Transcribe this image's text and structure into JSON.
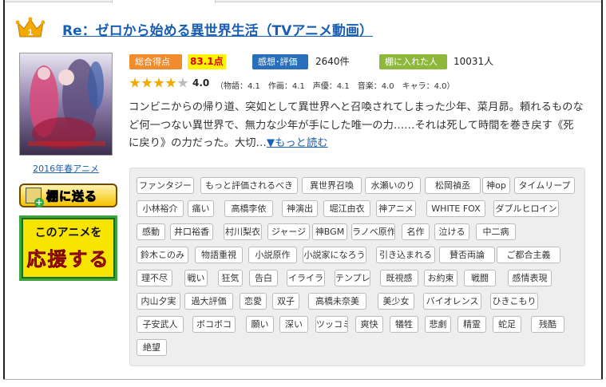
{
  "anime": {
    "rank": "1",
    "title": "Re：ゼロから始める異世界生活（TVアニメ動画）",
    "season": "2016年春アニメ"
  },
  "stats": {
    "total_score_label": "総合得点",
    "total_score": "83.1点",
    "reviews_label": "感想･評価",
    "reviews_count": "2640件",
    "shelf_label": "棚に入れた人",
    "shelf_count": "10031人"
  },
  "rating": {
    "overall": 4.0,
    "overall_text": "4.0",
    "stars_filled": 4,
    "stars_total": 5,
    "detail": "（物語：4.1　作画：4.1　声優：4.1　音楽：4.0　キャラ：4.0）"
  },
  "synopsis": {
    "text": "コンビニからの帰り道、突如として異世界へと召喚されてしまった少年、菜月昴。頼れるものなど何一つない異世界で、無力な少年が手にした唯一の力……それは死して時間を巻き戻す《死に戻り》の力だった。大切…",
    "more_label": "▼もっと読む"
  },
  "buttons": {
    "shelf": "棚に送る",
    "support_line1": "このアニメを",
    "support_line2": "応援する"
  },
  "tags": [
    "ファンタジー",
    "もっと評価されるべき",
    "異世界召喚",
    "水瀬いのり",
    "松岡禎丞",
    "神op",
    "タイムリープ",
    "小林裕介",
    "痛い",
    "高橋李依",
    "神演出",
    "堀江由衣",
    "神アニメ",
    "WHITE FOX",
    "ダブルヒロイン",
    "感動",
    "井口裕香",
    "村川梨衣",
    "ジャージ",
    "神BGM",
    "ラノベ原作",
    "名作",
    "泣ける",
    "中二病",
    "鈴木このみ",
    "物語重視",
    "小説原作",
    "小説家になろう",
    "引き込まれる",
    "賛否両論",
    "ご都合主義",
    "理不尽",
    "戦い",
    "狂気",
    "告白",
    "イライラ",
    "テンプレ",
    "既視感",
    "お約束",
    "戦闘",
    "感情表現",
    "内山夕実",
    "過大評価",
    "恋愛",
    "双子",
    "高橋未奈美",
    "美少女",
    "バイオレンス",
    "ひきこもり",
    "子安武人",
    "ボコボコ",
    "願い",
    "深い",
    "ツッコミ",
    "爽快",
    "犠牲",
    "悲劇",
    "精霊",
    "蛇足",
    "残酷",
    "絶望"
  ],
  "colors": {
    "link": "#1a5fb4",
    "score_bg": "#fff200",
    "score_text": "#e00000",
    "badge_orange": "#f08c2e",
    "badge_blue": "#2a6fb9",
    "badge_green": "#8db83b",
    "star": "#f2a900"
  }
}
